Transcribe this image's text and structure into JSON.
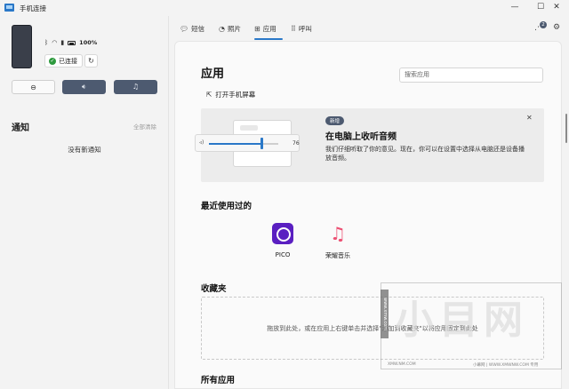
{
  "window": {
    "title": "手机连接",
    "controls": [
      "—",
      "☐",
      "✕"
    ]
  },
  "left": {
    "battery": "100%",
    "connected_label": "已连接",
    "notifications_title": "通知",
    "clear_all": "全部清除",
    "no_notifications": "没有新通知"
  },
  "nav": {
    "tabs": [
      {
        "label": "短信",
        "icon": "message-icon"
      },
      {
        "label": "照片",
        "icon": "photo-icon"
      },
      {
        "label": "应用",
        "icon": "apps-icon"
      },
      {
        "label": "呼叫",
        "icon": "dialpad-icon"
      }
    ],
    "active_tab": "应用",
    "notification_count": "2"
  },
  "main": {
    "title": "应用",
    "search_placeholder": "搜索应用",
    "open_screen": "打开手机屏幕",
    "banner": {
      "badge": "新增",
      "title": "在电脑上收听音频",
      "text": "我们仔细听取了你的意见。现在，你可以在设置中选择从电脑还是设备播放音频。",
      "slider_value": "76"
    },
    "recent_title": "最近使用过的",
    "recent_apps": [
      {
        "name": "PICO"
      },
      {
        "name": "荣耀音乐"
      }
    ],
    "favorites_title": "收藏夹",
    "dropzone_text": "拖放到此处，或在应用上右键单击并选择\"添加到收藏夹\"以将应用固定到此处",
    "all_apps_title": "所有应用"
  },
  "watermark": {
    "big": "小目网",
    "side": "www.xmw.com",
    "footer_left": "XMW.NM.COM",
    "footer_right": "小幕网 | WWW.XMWNW.COM 专用"
  },
  "colors": {
    "accent": "#2a78c8",
    "dark_button": "#4d5a70",
    "connected_green": "#2e9a3e"
  }
}
